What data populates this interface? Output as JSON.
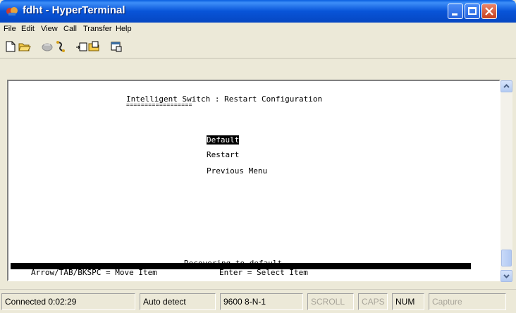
{
  "window": {
    "title": "fdht - HyperTerminal"
  },
  "menu": [
    "File",
    "Edit",
    "View",
    "Call",
    "Transfer",
    "Help"
  ],
  "toolbar_icons": [
    "new-icon",
    "open-icon",
    "connect-icon",
    "disconnect-icon",
    "send-icon",
    "receive-icon",
    "properties-icon"
  ],
  "terminal": {
    "heading": "Intelligent Switch : Restart Configuration",
    "underline": "==================",
    "options": [
      {
        "label": "Default",
        "selected": true
      },
      {
        "label": "Restart",
        "selected": false
      },
      {
        "label": "Previous Menu",
        "selected": false
      }
    ],
    "message": "Recovering to default.",
    "help_left": "Arrow/TAB/BKSPC = Move Item",
    "help_right": "Enter = Select Item"
  },
  "status": {
    "connected": "Connected 0:02:29",
    "detect": "Auto detect",
    "settings": "9600 8-N-1",
    "scroll": "SCROLL",
    "caps": "CAPS",
    "num": "NUM",
    "capture": "Capture"
  }
}
